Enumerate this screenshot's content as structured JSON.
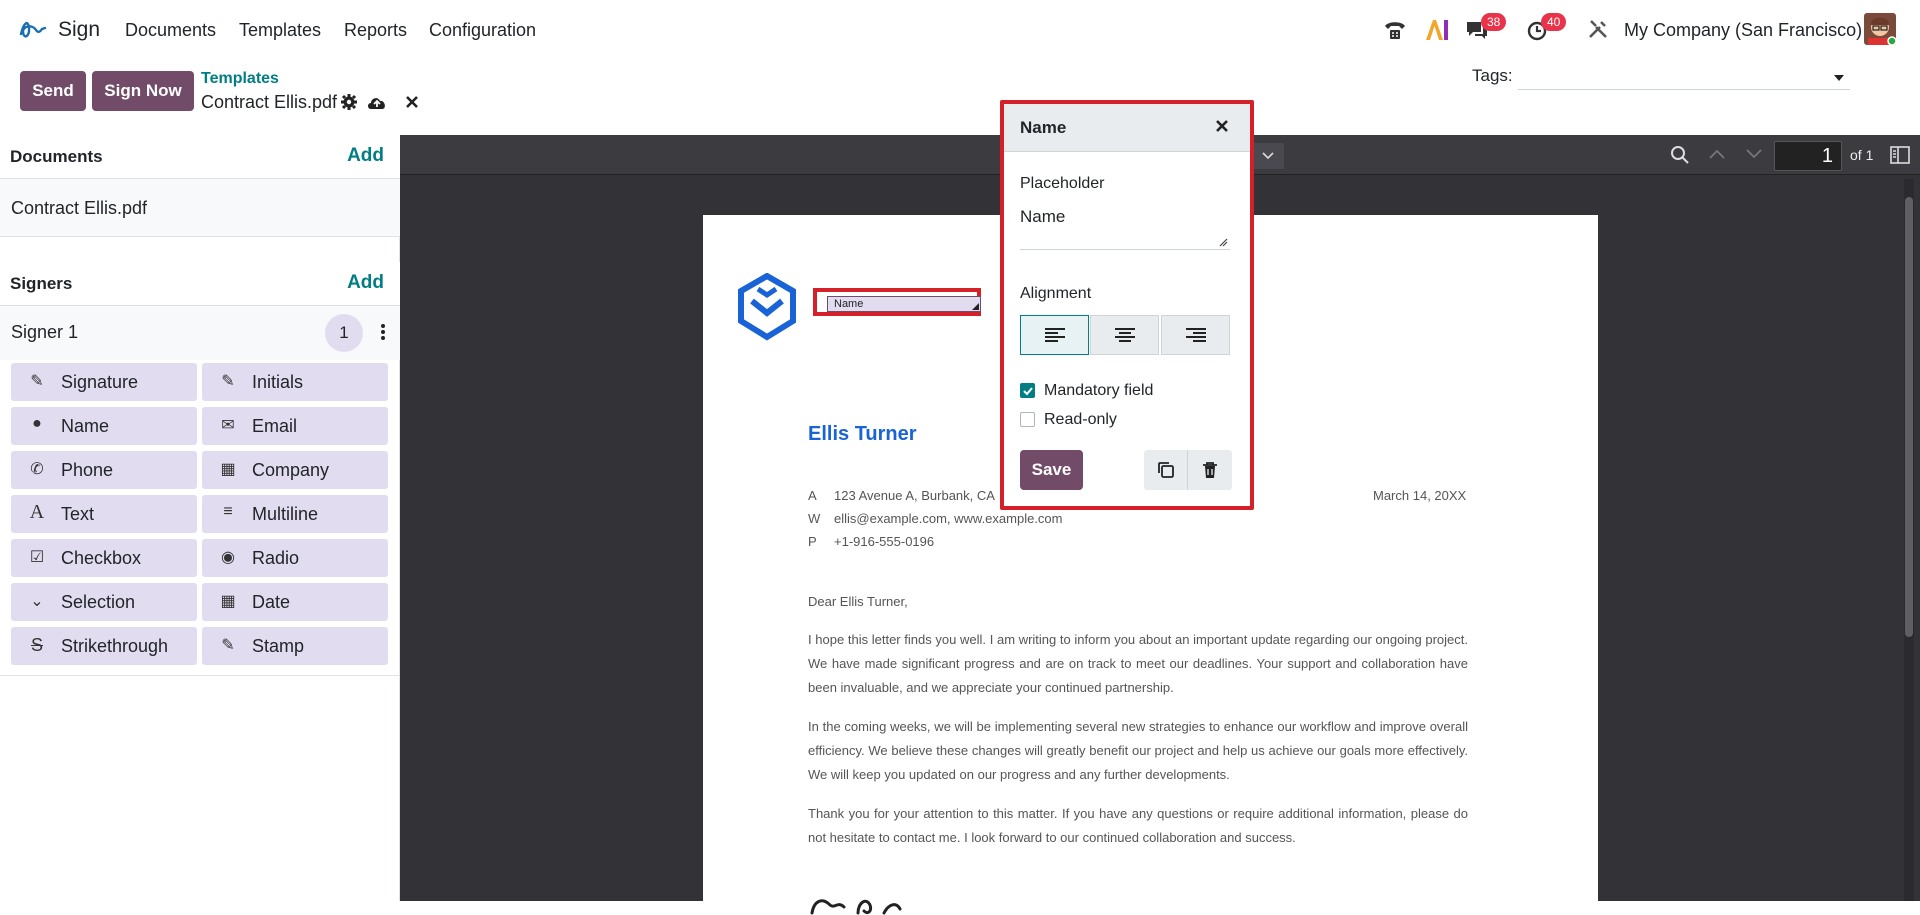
{
  "app": {
    "name": "Sign"
  },
  "nav": {
    "menu": [
      "Documents",
      "Templates",
      "Reports",
      "Configuration"
    ],
    "messages_count": "38",
    "activities_count": "40",
    "company": "My Company (San Francisco)"
  },
  "control": {
    "send_label": "Send",
    "sign_now_label": "Sign Now",
    "breadcrumb_parent": "Templates",
    "breadcrumb_current": "Contract Ellis.pdf",
    "tags_label": "Tags:"
  },
  "sidebar": {
    "documents_title": "Documents",
    "documents_add": "Add",
    "document_name": "Contract Ellis.pdf",
    "signers_title": "Signers",
    "signers_add": "Add",
    "signer_name": "Signer 1",
    "signer_count": "1",
    "fields": [
      {
        "label": "Signature",
        "icon": "signature-icon"
      },
      {
        "label": "Initials",
        "icon": "initials-icon"
      },
      {
        "label": "Name",
        "icon": "user-icon"
      },
      {
        "label": "Email",
        "icon": "envelope-icon"
      },
      {
        "label": "Phone",
        "icon": "phone-icon"
      },
      {
        "label": "Company",
        "icon": "building-icon"
      },
      {
        "label": "Text",
        "icon": "text-icon"
      },
      {
        "label": "Multiline",
        "icon": "lines-icon"
      },
      {
        "label": "Checkbox",
        "icon": "checkbox-icon"
      },
      {
        "label": "Radio",
        "icon": "radio-icon"
      },
      {
        "label": "Selection",
        "icon": "chevron-down-icon"
      },
      {
        "label": "Date",
        "icon": "calendar-icon"
      },
      {
        "label": "Strikethrough",
        "icon": "strikethrough-icon"
      },
      {
        "label": "Stamp",
        "icon": "stamp-icon"
      }
    ]
  },
  "viewer": {
    "page_number": "1",
    "page_total": "of 1"
  },
  "document": {
    "name_field": "Name",
    "sender_name": "Ellis Turner",
    "address_label": "A",
    "address": "123 Avenue A, Burbank, CA",
    "web_label": "W",
    "web": "ellis@example.com, www.example.com",
    "phone_label": "P",
    "phone": "+1-916-555-0196",
    "date": "March 14, 20XX",
    "salutation": "Dear Ellis Turner,",
    "para1": "I hope this letter finds you well. I am writing to inform you about an important update regarding our ongoing project. We have made significant progress and are on track to meet our deadlines. Your support and collaboration have been invaluable, and we appreciate your continued partnership.",
    "para2": "In the coming weeks, we will be implementing several new strategies to enhance our workflow and improve overall efficiency. We believe these changes will greatly benefit our project and help us achieve our goals more effectively. We will keep you updated on our progress and any further developments.",
    "para3": "Thank you for your attention to this matter. If you have any questions or require additional information, please do not hesitate to contact me. I look forward to our continued collaboration and success."
  },
  "popover": {
    "title": "Name",
    "placeholder_label": "Placeholder",
    "placeholder_value": "Name",
    "alignment_label": "Alignment",
    "mandatory_label": "Mandatory field",
    "mandatory_checked": true,
    "readonly_label": "Read-only",
    "readonly_checked": false,
    "save_label": "Save"
  }
}
